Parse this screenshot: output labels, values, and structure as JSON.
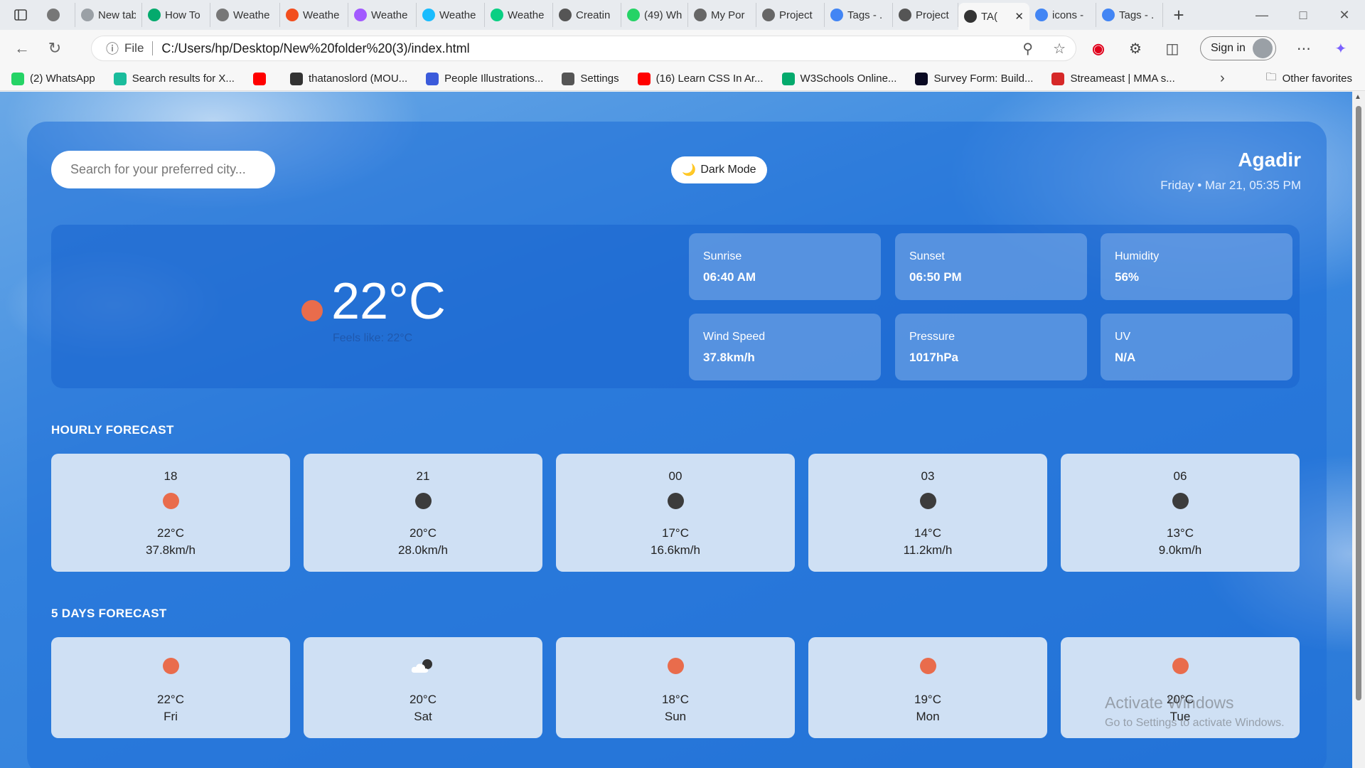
{
  "browser": {
    "tabs": [
      {
        "title": "",
        "icon": "gear-icon",
        "color": "#777777"
      },
      {
        "title": "New tab",
        "icon": "newtab-icon",
        "color": "#9aa0a6"
      },
      {
        "title": "How To",
        "icon": "w3-icon",
        "color": "#04aa6d"
      },
      {
        "title": "Weathe",
        "icon": "globe-icon",
        "color": "#777777"
      },
      {
        "title": "Weathe",
        "icon": "figma-icon",
        "color": "#f24e1e"
      },
      {
        "title": "Weathe",
        "icon": "figma-icon",
        "color": "#a259ff"
      },
      {
        "title": "Weathe",
        "icon": "figma-icon",
        "color": "#1abcfe"
      },
      {
        "title": "Weathe",
        "icon": "figma-icon",
        "color": "#0acf83"
      },
      {
        "title": "Creatin",
        "icon": "openai-icon",
        "color": "#555555"
      },
      {
        "title": "(49) Wh",
        "icon": "whatsapp-icon",
        "color": "#25d366"
      },
      {
        "title": "My Por",
        "icon": "alx-icon",
        "color": "#666666"
      },
      {
        "title": "Project",
        "icon": "alx-icon",
        "color": "#666666"
      },
      {
        "title": "Tags - .",
        "icon": "google-icon",
        "color": "#4285f4"
      },
      {
        "title": "Project",
        "icon": "openai-icon",
        "color": "#555555"
      },
      {
        "title": "TA(",
        "icon": "globe-icon",
        "color": "#333333"
      },
      {
        "title": "icons -",
        "icon": "google-icon",
        "color": "#4285f4"
      },
      {
        "title": "Tags - .",
        "icon": "google-icon",
        "color": "#4285f4"
      }
    ],
    "active_tab_index": 14,
    "address": {
      "scheme": "File",
      "url": "C:/Users/hp/Desktop/New%20folder%20(3)/index.html"
    },
    "signin_label": "Sign in",
    "bookmarks": [
      {
        "label": "(2) WhatsApp",
        "icon": "whatsapp-icon",
        "color": "#25d366"
      },
      {
        "label": "Search results for X...",
        "icon": "vertex-icon",
        "color": "#1abc9c"
      },
      {
        "label": "",
        "icon": "youtube-icon",
        "color": "#ff0000"
      },
      {
        "label": "thatanoslord (MOU...",
        "icon": "github-icon",
        "color": "#333333"
      },
      {
        "label": "People Illustrations...",
        "icon": "s-icon",
        "color": "#3b5bdb"
      },
      {
        "label": "Settings",
        "icon": "gear-icon",
        "color": "#555555"
      },
      {
        "label": "(16) Learn CSS In Ar...",
        "icon": "youtube-icon",
        "color": "#ff0000"
      },
      {
        "label": "W3Schools Online...",
        "icon": "w3-icon",
        "color": "#04aa6d"
      },
      {
        "label": "Survey Form: Build...",
        "icon": "fcc-icon",
        "color": "#0a0a23"
      },
      {
        "label": "Streameast | MMA s...",
        "icon": "streameast-icon",
        "color": "#d62828"
      }
    ],
    "other_favorites": "Other favorites"
  },
  "app": {
    "search_placeholder": "Search for your preferred city...",
    "dark_mode_label": "Dark Mode",
    "city": "Agadir",
    "date": "Friday • Mar 21, 05:35 PM",
    "current": {
      "temp": "22°C",
      "feels_like": "Feels like: 22°C",
      "icon_color": "#e96c4c"
    },
    "stats": [
      {
        "label": "Sunrise",
        "value": "06:40 AM"
      },
      {
        "label": "Sunset",
        "value": "06:50 PM"
      },
      {
        "label": "Humidity",
        "value": "56%"
      },
      {
        "label": "Wind Speed",
        "value": "37.8km/h"
      },
      {
        "label": "Pressure",
        "value": "1017hPa"
      },
      {
        "label": "UV",
        "value": "N/A"
      }
    ],
    "hourly_title": "HOURLY FORECAST",
    "hourly": [
      {
        "time": "18",
        "temp": "22°C",
        "wind": "37.8km/h",
        "icon_color": "#e96c4c"
      },
      {
        "time": "21",
        "temp": "20°C",
        "wind": "28.0km/h",
        "icon_color": "#3c3c3c"
      },
      {
        "time": "00",
        "temp": "17°C",
        "wind": "16.6km/h",
        "icon_color": "#3c3c3c"
      },
      {
        "time": "03",
        "temp": "14°C",
        "wind": "11.2km/h",
        "icon_color": "#3c3c3c"
      },
      {
        "time": "06",
        "temp": "13°C",
        "wind": "9.0km/h",
        "icon_color": "#3c3c3c"
      }
    ],
    "daily_title": "5 DAYS FORECAST",
    "daily": [
      {
        "temp": "22°C",
        "day": "Fri",
        "icon": "sun",
        "icon_color": "#e96c4c"
      },
      {
        "temp": "20°C",
        "day": "Sat",
        "icon": "cloud-night",
        "icon_color": "#ffffff"
      },
      {
        "temp": "18°C",
        "day": "Sun",
        "icon": "sun",
        "icon_color": "#e96c4c"
      },
      {
        "temp": "19°C",
        "day": "Mon",
        "icon": "sun",
        "icon_color": "#e96c4c"
      },
      {
        "temp": "20°C",
        "day": "Tue",
        "icon": "sun",
        "icon_color": "#e96c4c"
      }
    ]
  },
  "os_watermark": {
    "title": "Activate Windows",
    "subtitle": "Go to Settings to activate Windows."
  }
}
